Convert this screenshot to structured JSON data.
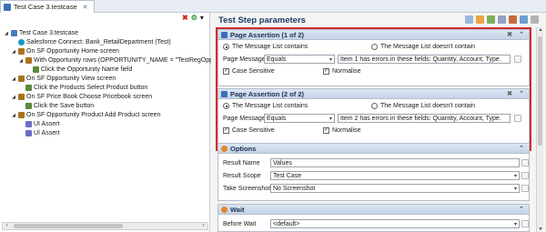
{
  "editor_tab": {
    "label": "Test Case 3.testcase",
    "close": "✕"
  },
  "tree": {
    "nodes": [
      {
        "label": "Test Case 3.testcase",
        "indent": 0,
        "icon": "test-case-icon",
        "expander": "◢"
      },
      {
        "label": "Salesforce Connect: Bank_RetailDepartment (Test)",
        "indent": 1,
        "icon": "salesforce-icon",
        "expander": ""
      },
      {
        "label": "On SF Opportunity Home screen",
        "indent": 1,
        "icon": "screen-icon",
        "expander": "◢"
      },
      {
        "label": "With Opportunity rows (OPPORTUNITY_NAME = \"TestRegOpp",
        "indent": 2,
        "icon": "rows-icon",
        "expander": "◢"
      },
      {
        "label": "Click the Opportunity Name field",
        "indent": 3,
        "icon": "step-icon",
        "expander": ""
      },
      {
        "label": "On SF Opportunity View screen",
        "indent": 1,
        "icon": "screen-icon",
        "expander": "◢"
      },
      {
        "label": "Click the Products Select Product button",
        "indent": 2,
        "icon": "step-icon",
        "expander": ""
      },
      {
        "label": "On SF Price Book Choose Pricebook screen",
        "indent": 1,
        "icon": "screen-icon",
        "expander": "◢"
      },
      {
        "label": "Click the Save button",
        "indent": 2,
        "icon": "step-icon",
        "expander": ""
      },
      {
        "label": "On SF Opportunity Product Add Product screen",
        "indent": 1,
        "icon": "screen-icon",
        "expander": "◢"
      },
      {
        "label": "UI Assert",
        "indent": 2,
        "icon": "assert-icon",
        "expander": ""
      },
      {
        "label": "UI Assert",
        "indent": 2,
        "icon": "assert-icon",
        "expander": ""
      }
    ],
    "scroll_left": "‹",
    "scroll_right": "›"
  },
  "toolbar_left": {
    "delete_icon": "✖",
    "run_icon": "⚙",
    "menu": "▾"
  },
  "panel": {
    "title": "Test Step parameters"
  },
  "assertions": [
    {
      "title": "Page Assertion (1 of 2)",
      "radio_contains": "The Message List contains",
      "radio_not_contains": "The Message List doesn't contain",
      "page_messages_label": "Page Messages",
      "operator": "Equals",
      "message_value": "Item 1 has errors in these fields: Quantity, Account, Type.",
      "case_sensitive_label": "Case Sensitive",
      "normalise_label": "Normalise",
      "check_mark": "✓"
    },
    {
      "title": "Page Assertion (2 of 2)",
      "radio_contains": "The Message List contains",
      "radio_not_contains": "The Message List doesn't contain",
      "page_messages_label": "Page Messages",
      "operator": "Equals",
      "message_value": "Item 2 has errors in these fields: Quantity, Account, Type.",
      "case_sensitive_label": "Case Sensitive",
      "normalise_label": "Normalise",
      "check_mark": "✓"
    }
  ],
  "options": {
    "title": "Options",
    "result_name_label": "Result Name",
    "result_name_value": "Values",
    "result_scope_label": "Result Scope",
    "result_scope_value": "Test Case",
    "take_screenshot_label": "Take Screenshot",
    "take_screenshot_value": "No Screenshot"
  },
  "wait": {
    "title": "Wait",
    "before_wait_label": "Before Wait",
    "before_wait_value": "<default>"
  },
  "glyphs": {
    "close": "✖",
    "collapse": "⌃",
    "carat": "▾",
    "up": "▲",
    "down": "▼"
  },
  "colors": {
    "accent": "#d02d2d",
    "section_header": "#c5d4e8"
  }
}
